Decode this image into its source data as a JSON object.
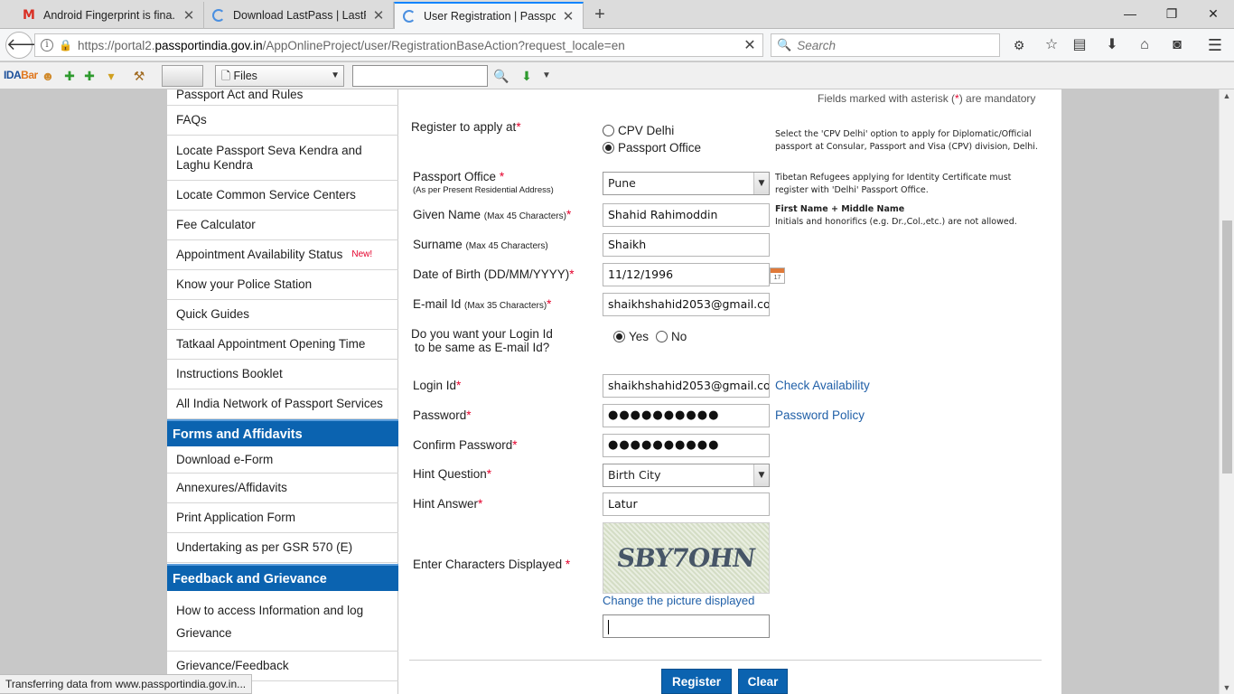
{
  "browser": {
    "tabs": [
      {
        "title": "Android Fingerprint is fina...",
        "favicon": "gmail-icon"
      },
      {
        "title": "Download LastPass | LastP...",
        "favicon": "loading-icon"
      },
      {
        "title": "User Registration | Passpor...",
        "favicon": "loading-icon",
        "active": true
      }
    ],
    "url_prefix": "https://portal2.",
    "url_host": "passportindia.gov.in",
    "url_path": "/AppOnlineProject/user/RegistrationBaseAction?request_locale=en",
    "search_placeholder": "Search",
    "status_text": "Transferring data from www.passportindia.gov.in..."
  },
  "idabar": {
    "logo_main": "IDA",
    "logo_accent": "Bar",
    "files_label": "Files"
  },
  "sidebar": {
    "items_top": [
      "Passport Act and Rules",
      "FAQs",
      "Locate Passport Seva Kendra and Laghu Kendra",
      "Locate Common Service Centers",
      "Fee Calculator",
      "Appointment Availability Status",
      "Know your Police Station",
      "Quick Guides",
      "Tatkaal Appointment Opening Time",
      "Instructions Booklet",
      "All India Network of Passport Services"
    ],
    "new_badge": "New!",
    "section_forms": "Forms and Affidavits",
    "items_forms": [
      "Download e-Form",
      "Annexures/Affidavits",
      "Print Application Form",
      "Undertaking as per GSR 570 (E)"
    ],
    "section_feedback": "Feedback and Grievance",
    "items_feedback": [
      "How to access Information and log Grievance",
      "Grievance/Feedback"
    ]
  },
  "form": {
    "mandatory_prefix": "Fields marked with asterisk (",
    "mandatory_star": "*",
    "mandatory_suffix": ") are mandatory",
    "register_label": "Register to apply at",
    "option_cpv": "CPV Delhi",
    "option_po": "Passport Office",
    "cpv_hint": "Select the 'CPV Delhi' option to apply for Diplomatic/Official passport at Consular, Passport and Visa (CPV) division, Delhi.",
    "passport_office_label": "Passport Office",
    "passport_office_sub": "(As per Present Residential Address)",
    "passport_office_value": "Pune",
    "tibetan_hint": "Tibetan Refugees applying for Identity Certificate must register with 'Delhi' Passport Office.",
    "given_name_label": "Given Name",
    "given_name_sub": "(Max 45 Characters)",
    "given_name_value": "Shahid Rahimoddin",
    "name_hint_bold": "First Name + Middle Name",
    "name_hint": "Initials and honorifics (e.g. Dr.,Col.,etc.) are not allowed.",
    "surname_label": "Surname",
    "surname_sub": "(Max 45 Characters)",
    "surname_value": "Shaikh",
    "dob_label": "Date of Birth (DD/MM/YYYY)",
    "dob_value": "11/12/1996",
    "calendar_day": "17",
    "email_label": "E-mail Id",
    "email_sub": "(Max 35 Characters)",
    "email_value": "shaikhshahid2053@gmail.com",
    "login_same_q1": "Do you want your Login Id",
    "login_same_q2": "to be same as E-mail Id?",
    "yes": "Yes",
    "no": "No",
    "login_label": "Login Id",
    "login_value": "shaikhshahid2053@gmail.com",
    "check_availability": "Check Availability",
    "password_label": "Password",
    "password_value": "●●●●●●●●●●",
    "password_policy": "Password Policy",
    "confirm_label": "Confirm Password",
    "confirm_value": "●●●●●●●●●●",
    "hint_q_label": "Hint Question",
    "hint_q_value": "Birth City",
    "hint_a_label": "Hint Answer",
    "hint_a_value": "Latur",
    "captcha_label": "Enter Characters Displayed",
    "captcha_text": "SBY7OHN",
    "change_picture": "Change the picture displayed",
    "register_btn": "Register",
    "clear_btn": "Clear"
  }
}
